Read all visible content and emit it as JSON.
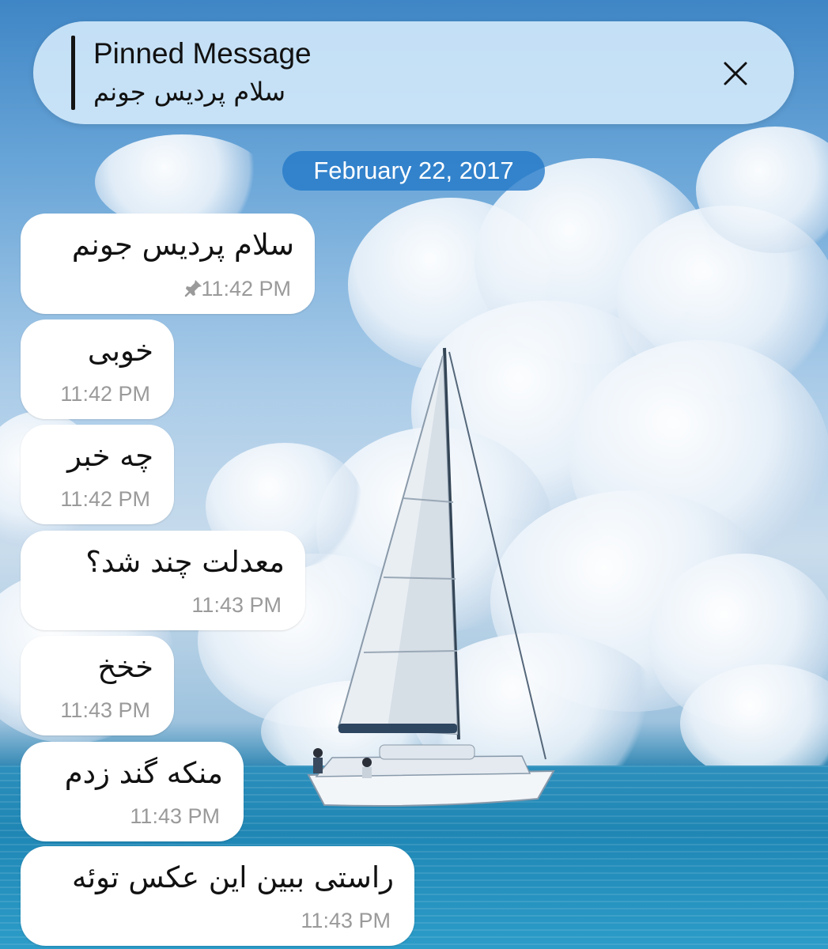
{
  "pinned": {
    "title": "Pinned Message",
    "text": "سلام پردیس جونم",
    "close_icon": "close-icon"
  },
  "date_separator": "February 22, 2017",
  "messages": [
    {
      "text": "سلام پردیس جونم",
      "time": "11:42 PM",
      "pinned": true
    },
    {
      "text": "خوبی",
      "time": "11:42 PM",
      "pinned": false
    },
    {
      "text": "چه خبر",
      "time": "11:42 PM",
      "pinned": false
    },
    {
      "text": "معدلت چند شد؟",
      "time": "11:43 PM",
      "pinned": false
    },
    {
      "text": "خخخ",
      "time": "11:43 PM",
      "pinned": false
    },
    {
      "text": "منکه گند زدم",
      "time": "11:43 PM",
      "pinned": false
    },
    {
      "text": "راستی ببین این عکس توئه",
      "time": "11:43 PM",
      "pinned": false
    }
  ],
  "colors": {
    "bubble": "#ffffff",
    "date_pill": "#2378c8",
    "pinned_bg": "#d6ecfc",
    "time": "#9a9a9a"
  }
}
